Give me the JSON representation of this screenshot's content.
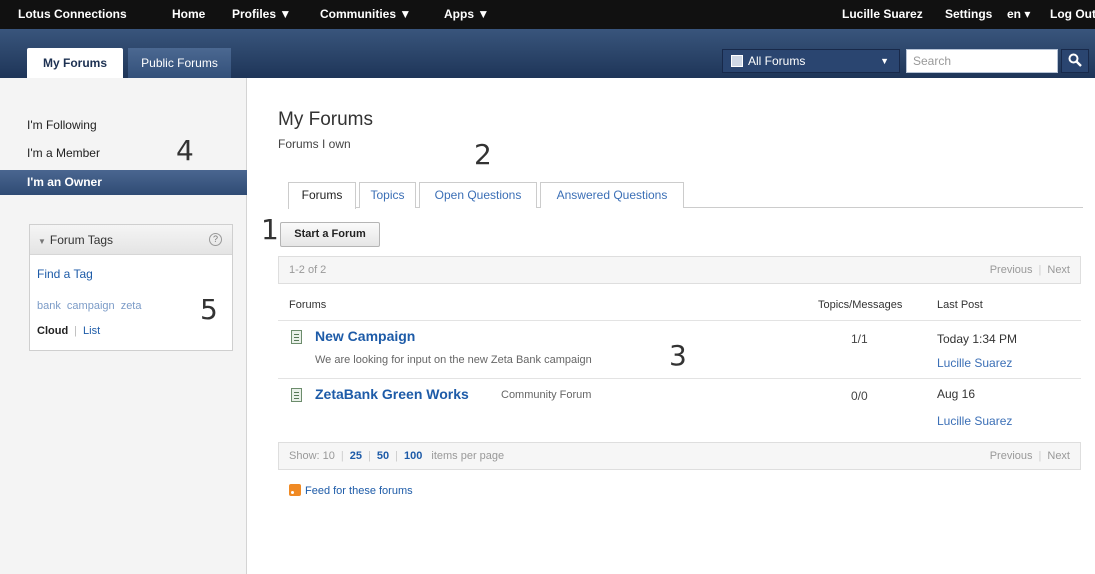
{
  "topbar": {
    "brand": "Lotus Connections",
    "nav": [
      "Home",
      "Profiles ▼",
      "Communities ▼",
      "Apps ▼"
    ],
    "user": "Lucille Suarez",
    "settings": "Settings",
    "lang": "en ▾",
    "logout": "Log Out"
  },
  "header": {
    "tabs": [
      "My Forums",
      "Public Forums"
    ],
    "scope_label": "All Forums",
    "search_placeholder": "Search"
  },
  "sidebar": {
    "items": [
      {
        "label": "I'm Following"
      },
      {
        "label": "I'm a Member"
      },
      {
        "label": "I'm an Owner"
      }
    ],
    "tags_box": {
      "title": "Forum Tags",
      "help": "?",
      "find_tag": "Find a Tag",
      "tags": [
        "bank",
        "campaign",
        "zeta"
      ],
      "views": [
        "Cloud",
        "List"
      ]
    }
  },
  "main": {
    "title": "My Forums",
    "subtitle": "Forums I own",
    "tabs": [
      "Forums",
      "Topics",
      "Open Questions",
      "Answered Questions"
    ],
    "start_button": "Start a Forum",
    "range": "1-2 of 2",
    "previous": "Previous",
    "next": "Next",
    "columns": [
      "Forums",
      "Topics/Messages",
      "Last Post"
    ],
    "forums": [
      {
        "name": "New Campaign",
        "community": "",
        "description": "We are looking for input on the new Zeta Bank campaign",
        "counts": "1/1",
        "last_post": "Today 1:34 PM",
        "author": "Lucille Suarez"
      },
      {
        "name": "ZetaBank Green Works",
        "community": "Community Forum",
        "description": "",
        "counts": "0/0",
        "last_post": "Aug 16",
        "author": "Lucille Suarez"
      }
    ],
    "show_label": "Show: 10",
    "page_sizes": [
      "25",
      "50",
      "100"
    ],
    "per_page": "items per page",
    "feed": "Feed for these forums"
  },
  "annotations": [
    "1",
    "2",
    "3",
    "4",
    "5"
  ]
}
